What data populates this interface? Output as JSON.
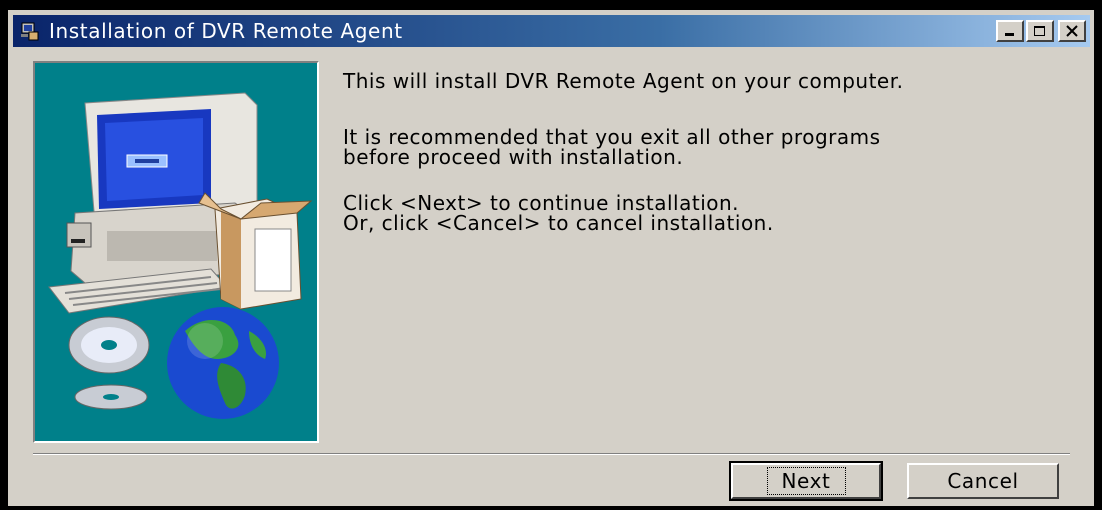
{
  "window": {
    "title": "Installation of DVR Remote Agent"
  },
  "titlebar_buttons": {
    "minimize_icon": "minimize-icon",
    "maximize_icon": "maximize-icon",
    "close_icon": "close-icon"
  },
  "content": {
    "line1": "This will install DVR Remote Agent on your computer.",
    "line2a": "It is recommended that you exit all other programs",
    "line2b": "before proceed with installation.",
    "line3a": "Click <Next> to continue installation.",
    "line3b": "Or, click <Cancel> to cancel installation."
  },
  "buttons": {
    "next": "Next",
    "cancel": "Cancel"
  },
  "colors": {
    "panel": "#00808a",
    "face": "#d4d0c8",
    "title_start": "#0a246a"
  }
}
